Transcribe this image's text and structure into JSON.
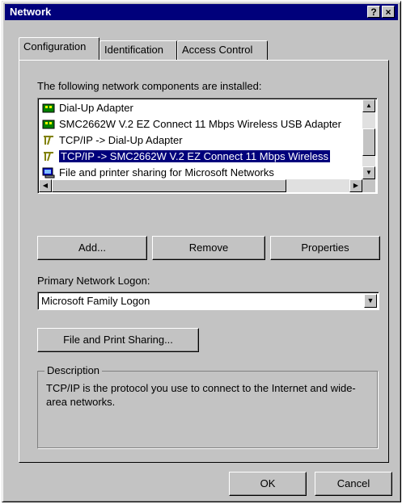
{
  "window": {
    "title": "Network",
    "help_button": "?",
    "close_button": "×"
  },
  "tabs": [
    {
      "label": "Configuration",
      "active": true
    },
    {
      "label": "Identification",
      "active": false
    },
    {
      "label": "Access Control",
      "active": false
    }
  ],
  "components": {
    "label": "The following network components are installed:",
    "items": [
      {
        "label": "Dial-Up Adapter",
        "icon": "network-adapter-icon",
        "selected": false
      },
      {
        "label": "SMC2662W V.2 EZ Connect 11 Mbps Wireless USB Adapter",
        "icon": "network-adapter-icon",
        "selected": false
      },
      {
        "label": "TCP/IP -> Dial-Up Adapter",
        "icon": "protocol-icon",
        "selected": false
      },
      {
        "label": "TCP/IP -> SMC2662W V.2 EZ Connect 11 Mbps Wireless",
        "icon": "protocol-icon",
        "selected": true
      },
      {
        "label": "File and printer sharing for Microsoft Networks",
        "icon": "file-sharing-icon",
        "selected": false
      }
    ]
  },
  "buttons": {
    "add": "Add...",
    "remove": "Remove",
    "properties": "Properties",
    "file_print_sharing": "File and Print Sharing...",
    "ok": "OK",
    "cancel": "Cancel"
  },
  "logon": {
    "label": "Primary Network Logon:",
    "value": "Microsoft Family Logon"
  },
  "description": {
    "legend": "Description",
    "text": "TCP/IP is the protocol you use to connect to the Internet and wide-area networks."
  },
  "colors": {
    "face": "#c3c3c3",
    "titlebar": "#00007b",
    "selection": "#00007b"
  }
}
